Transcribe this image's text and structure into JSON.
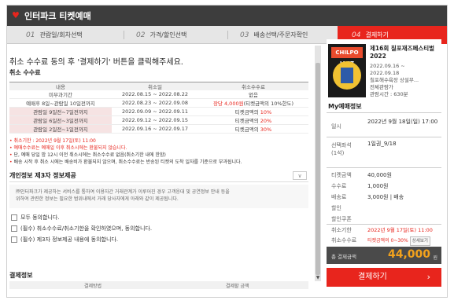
{
  "app": {
    "title": "인터파크 티켓예매"
  },
  "steps": [
    {
      "num": "01",
      "label": "관람일/회차선택"
    },
    {
      "num": "02",
      "label": "가격/할인선택"
    },
    {
      "num": "03",
      "label": "배송선택/주문자확인"
    },
    {
      "num": "04",
      "label": "결제하기"
    }
  ],
  "main": {
    "headline": "취소 수수료 동의 후 '결제하기' 버튼을 클릭해주세요.",
    "fee_section_title": "취소 수수료",
    "fee_table": {
      "headers": [
        "내용",
        "취소일",
        "취소수수료"
      ],
      "rows": [
        {
          "content": "미부과기간",
          "date": "2022.08.15 ~ 2022.08.22",
          "fee": "없음"
        },
        {
          "content": "예매후 8일~관람일 10일전까지",
          "date": "2022.08.23 ~ 2022.09.08",
          "fee_red": "장당 4,000원",
          "fee": "(티켓금액의 10%한도)"
        },
        {
          "content": "관람일 9일전~7일전까지",
          "date": "2022.09.09 ~ 2022.09.11",
          "fee": "티켓금액의 ",
          "fee_red": "10%"
        },
        {
          "content": "관람일 6일전~3일전까지",
          "date": "2022.09.12 ~ 2022.09.15",
          "fee": "티켓금액의 ",
          "fee_red": "20%"
        },
        {
          "content": "관람일 2일전~1일전까지",
          "date": "2022.09.16 ~ 2022.09.17",
          "fee": "티켓금액의 ",
          "fee_red": "30%"
        }
      ]
    },
    "notes": [
      "취소기한 : 2022년 9월 17일(토) 11:00",
      "예매수수료는 예매일 이후 취소시에는 환불되지 않습니다.",
      "단, 예매 당일 밤 12시 이전 취소시에는 취소수수료 없음(취소기한 내에 한함)",
      "배송 시작 후 취소 시에는 배송비가 환불되지 않으며, 취소수수료는 반송된 티켓의 도착 일자를 기준으로 부과됩니다."
    ],
    "privacy": {
      "title": "개인정보 제3자 정보제공",
      "toggle": "∨",
      "body_line1": "㈜인터파크가 제공하는 서비스를 통하여 이용자간 거래관계가 이루어진 경우 고객응대 및 공연정보 안내 등을",
      "body_line2": "위하여 관련한 정보는 필요한 범위내에서 거래 당사자에게 아래와 같이 제공됩니다."
    },
    "agreements": [
      "모두 동의합니다.",
      "(필수) 취소수수료/취소기한을 확인하였으며, 동의합니다.",
      "(필수) 제3자 정보제공 내용에 동의합니다."
    ],
    "payment": {
      "title": "결제정보",
      "headers": [
        "결제방법",
        "결제할 금액"
      ]
    }
  },
  "sidebar": {
    "poster_text": "CHILPO JAZZ",
    "show_title": "제16회 칠포재즈페스티벌2022",
    "show_info": [
      "2022.09.16 ~",
      "2022.09.18",
      "칠포해수욕장 상설무...",
      "전체관람가",
      "관람시간 : 630분"
    ],
    "my_title": "My예매정보",
    "rows": [
      {
        "key": "일시",
        "value": "2022년 9월 18일(일) 17:00"
      },
      {
        "key": "선택좌석\n(1석)",
        "value": "1일권_9/18"
      },
      {
        "key": "티켓금액",
        "value": "40,000원"
      },
      {
        "key": "수수료",
        "value": "1,000원"
      },
      {
        "key": "배송료",
        "value": "3,000원 | 배송"
      },
      {
        "key": "할인",
        "value": ""
      },
      {
        "key": "할인쿠폰",
        "value": ""
      },
      {
        "key": "취소기한",
        "value": "2022년 9월 17일(토) 11:00"
      },
      {
        "key": "취소수수료",
        "value": "티켓금액의 0~30%",
        "button": "상세보기"
      }
    ],
    "total_label": "총 결제금액",
    "total_value": "44,000",
    "total_unit": "원",
    "pay_button": "결제하기",
    "pay_arrow": "›"
  },
  "colors": {
    "accent": "#e8251d",
    "topbar": "#3d3d3d",
    "total_value": "#f3a21c"
  }
}
